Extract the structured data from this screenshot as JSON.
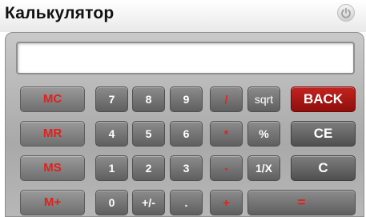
{
  "window": {
    "title": "Калькулятор",
    "power_icon": "power-icon"
  },
  "display": {
    "value": ""
  },
  "memory": [
    "MC",
    "MR",
    "MS",
    "M+"
  ],
  "digits": {
    "row1": [
      "7",
      "8",
      "9"
    ],
    "row2": [
      "4",
      "5",
      "6"
    ],
    "row3": [
      "1",
      "2",
      "3"
    ],
    "row4": [
      "0",
      "+/-",
      "."
    ]
  },
  "operators": {
    "divide": "/",
    "multiply": "*",
    "minus": "-",
    "plus": "+",
    "equals": "="
  },
  "functions": {
    "sqrt": "sqrt",
    "percent": "%",
    "reciprocal": "1/X"
  },
  "controls": {
    "back": "BACK",
    "ce": "CE",
    "c": "C"
  },
  "colors": {
    "accent_red": "#e2201c",
    "back_button": "#b01a17",
    "key_gray": "#6f6f6f"
  }
}
